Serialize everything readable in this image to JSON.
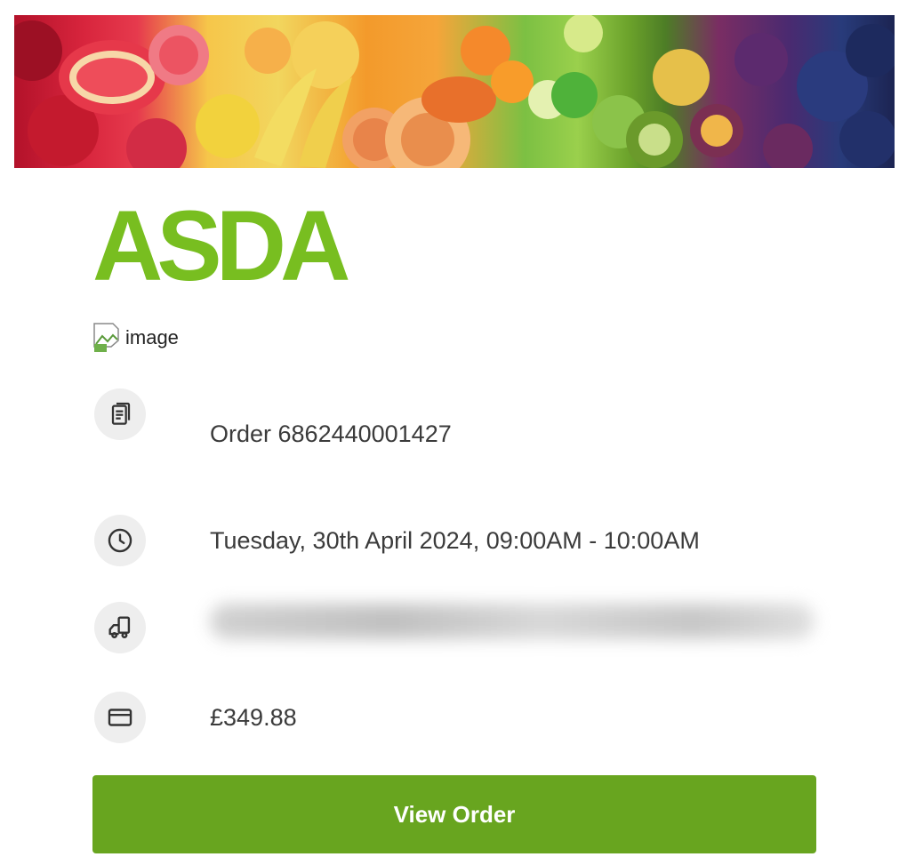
{
  "brand": {
    "name": "ASDA",
    "color": "#78be20"
  },
  "broken_image": {
    "alt": "image",
    "icon": "broken-image-icon"
  },
  "order": {
    "label": "Order 6862440001427",
    "slot": "Tuesday, 30th April 2024, 09:00AM - 10:00AM",
    "total": "£349.88"
  },
  "icons": {
    "order": "document-icon",
    "slot": "clock-icon",
    "delivery": "delivery-van-icon",
    "payment": "credit-card-icon"
  },
  "actions": {
    "view_order": "View Order",
    "button_color": "#68a51f"
  }
}
